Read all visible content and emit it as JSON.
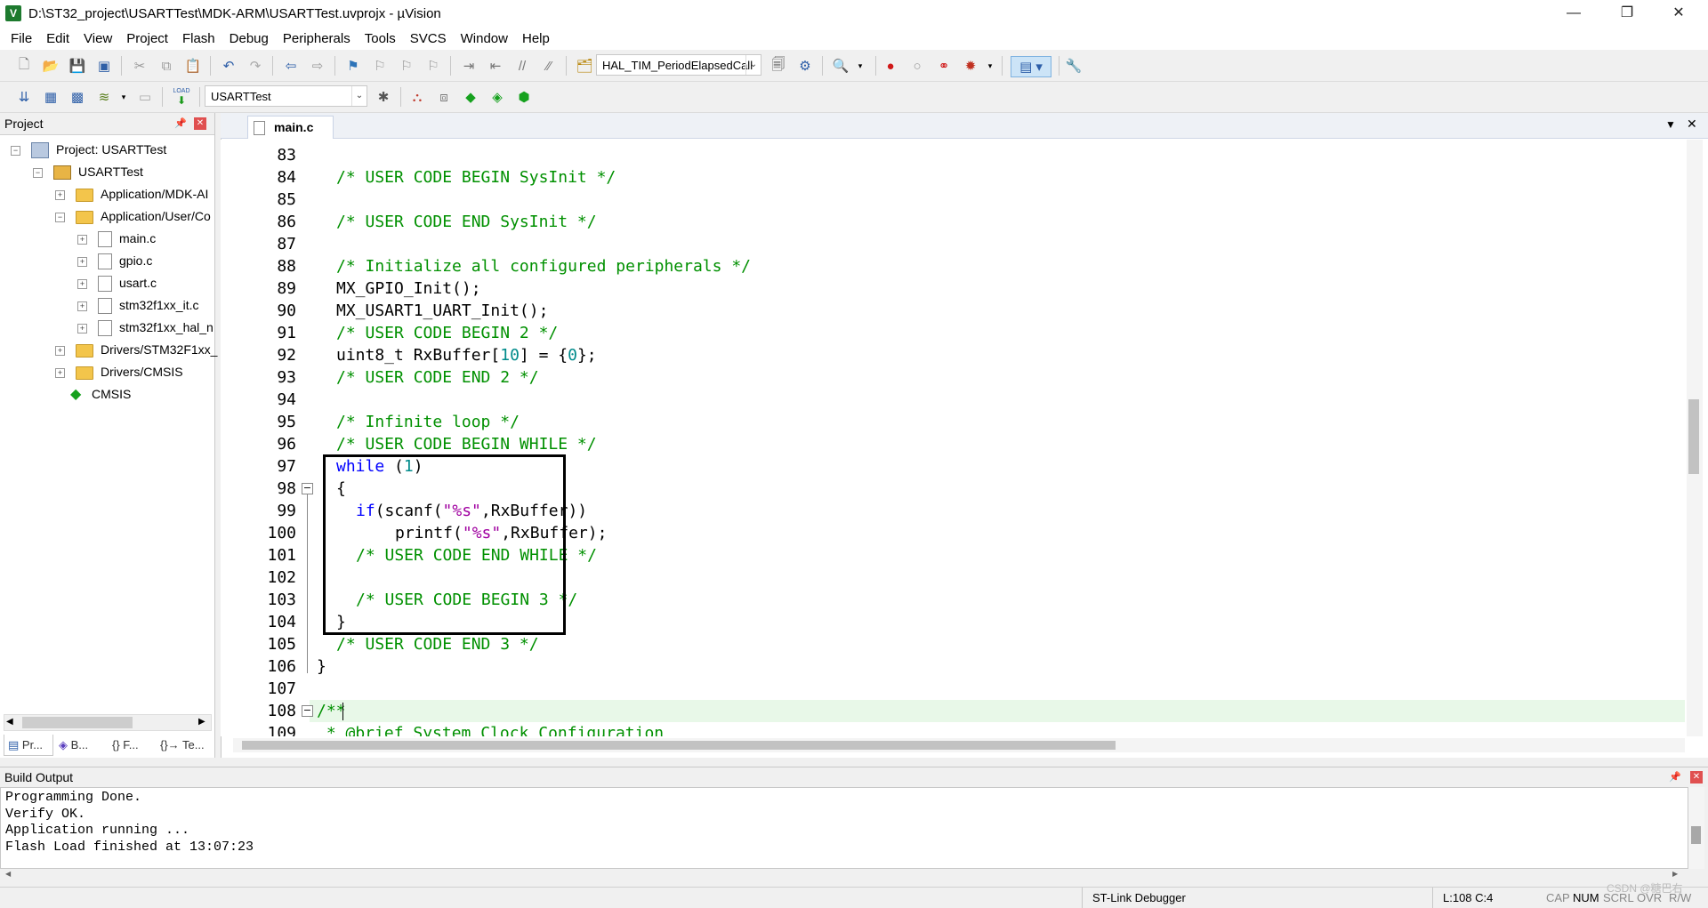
{
  "window": {
    "title": "D:\\ST32_project\\USARTTest\\MDK-ARM\\USARTTest.uvprojx - µVision",
    "minimize": "—",
    "restore": "❐",
    "close": "✕"
  },
  "menu": [
    "File",
    "Edit",
    "View",
    "Project",
    "Flash",
    "Debug",
    "Peripherals",
    "Tools",
    "SVCS",
    "Window",
    "Help"
  ],
  "toolbar": {
    "function_combo": "HAL_TIM_PeriodElapsedCall",
    "target_combo": "USARTTest",
    "load_label": "LOAD"
  },
  "project_pane": {
    "title": "Project",
    "pin": "📌",
    "close": "✕",
    "tree": [
      {
        "label": "Project: USARTTest"
      },
      {
        "label": "USARTTest"
      },
      {
        "label": "Application/MDK-AI"
      },
      {
        "label": "Application/User/Co"
      },
      {
        "label": "main.c"
      },
      {
        "label": "gpio.c"
      },
      {
        "label": "usart.c"
      },
      {
        "label": "stm32f1xx_it.c"
      },
      {
        "label": "stm32f1xx_hal_n"
      },
      {
        "label": "Drivers/STM32F1xx_"
      },
      {
        "label": "Drivers/CMSIS"
      },
      {
        "label": "CMSIS"
      }
    ],
    "tabs": [
      "Pr...",
      "B...",
      "{} F...",
      "{}→ Te..."
    ]
  },
  "editor": {
    "tab": "main.c",
    "lines": [
      {
        "n": "83"
      },
      {
        "n": "84"
      },
      {
        "n": "85"
      },
      {
        "n": "86"
      },
      {
        "n": "87"
      },
      {
        "n": "88"
      },
      {
        "n": "89"
      },
      {
        "n": "90"
      },
      {
        "n": "91"
      },
      {
        "n": "92"
      },
      {
        "n": "93"
      },
      {
        "n": "94"
      },
      {
        "n": "95"
      },
      {
        "n": "96"
      },
      {
        "n": "97"
      },
      {
        "n": "98"
      },
      {
        "n": "99"
      },
      {
        "n": "100"
      },
      {
        "n": "101"
      },
      {
        "n": "102"
      },
      {
        "n": "103"
      },
      {
        "n": "104"
      },
      {
        "n": "105"
      },
      {
        "n": "106"
      },
      {
        "n": "107"
      },
      {
        "n": "108"
      },
      {
        "n": "109"
      }
    ],
    "code": {
      "l84": "/* USER CODE BEGIN SysInit */",
      "l86": "/* USER CODE END SysInit */",
      "l88": "/* Initialize all configured peripherals */",
      "l89": "MX_GPIO_Init();",
      "l90": "MX_USART1_UART_Init();",
      "l91": "/* USER CODE BEGIN 2 */",
      "l92a": "uint8_t RxBuffer[",
      "l92b": "10",
      "l92c": "] = {",
      "l92d": "0",
      "l92e": "};",
      "l93": "/* USER CODE END 2 */",
      "l95": "/* Infinite loop */",
      "l96": "/* USER CODE BEGIN WHILE */",
      "l97a": "while",
      "l97b": " (",
      "l97c": "1",
      "l97d": ")",
      "l98": "{",
      "l99a": "if",
      "l99b": "(scanf(",
      "l99c": "\"%s\"",
      "l99d": ",RxBuffer))",
      "l100a": "printf(",
      "l100b": "\"%s\"",
      "l100c": ",RxBuffer);",
      "l101": "/* USER CODE END WHILE */",
      "l103": "/* USER CODE BEGIN 3 */",
      "l104": "}",
      "l105": "/* USER CODE END 3 */",
      "l106": "}",
      "l108": "/**",
      "l109": " * @brief System Clock Configuration"
    }
  },
  "build_output": {
    "title": "Build Output",
    "lines": [
      "Programming Done.",
      "Verify OK.",
      "Application running ...",
      "Flash Load finished at 13:07:23"
    ]
  },
  "statusbar": {
    "debugger": "ST-Link Debugger",
    "position": "L:108 C:4",
    "flags": [
      "CAP",
      "NUM",
      "SCRL",
      "OVR",
      "R/W"
    ],
    "watermark": "CSDN @糖巴右"
  },
  "colors": {
    "comment": "#009000",
    "keyword": "#0000ff",
    "number": "#008b8b",
    "string": "#a000a0",
    "current_line": "#e8f8e8"
  }
}
